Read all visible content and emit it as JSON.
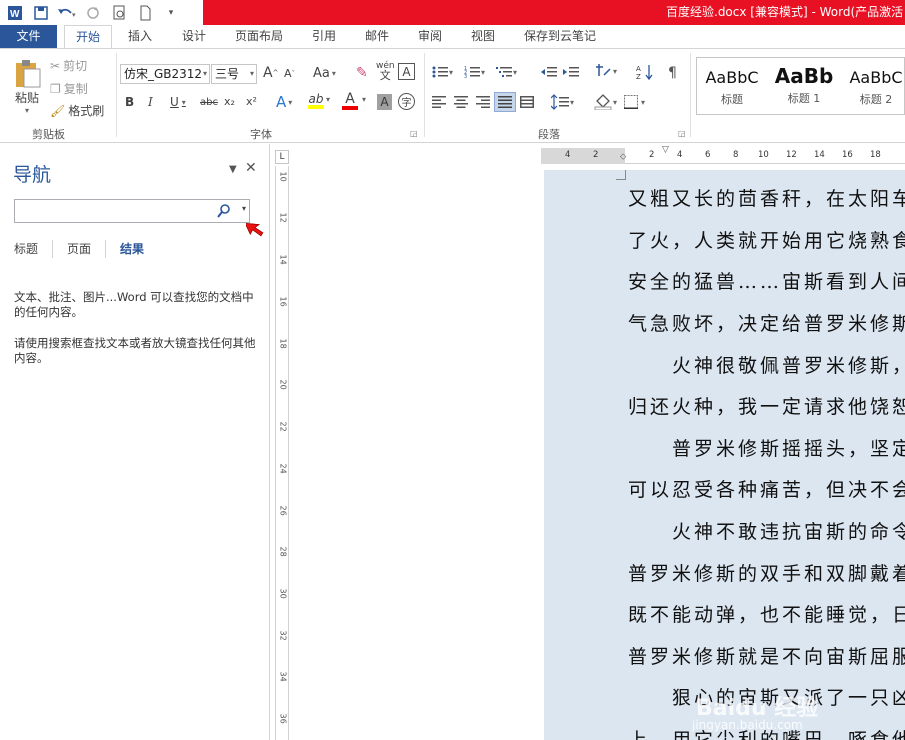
{
  "app": {
    "title": "百度经验.docx [兼容模式] - Word(产品激活",
    "accent": "#2b579a",
    "titlebar_color": "#e81123"
  },
  "qat": {
    "icons": [
      "word-logo-icon",
      "save-icon",
      "undo-icon",
      "redo-icon",
      "print-preview-icon",
      "new-doc-icon",
      "customize-icon"
    ]
  },
  "tabs": [
    "文件",
    "开始",
    "插入",
    "设计",
    "页面布局",
    "引用",
    "邮件",
    "审阅",
    "视图",
    "保存到云笔记"
  ],
  "ribbon": {
    "clipboard": {
      "paste": "粘贴",
      "cut": "剪切",
      "copy": "复制",
      "format_painter": "格式刷",
      "label": "剪贴板"
    },
    "font": {
      "font_name": "仿宋_GB2312",
      "font_size": "三号",
      "label": "字体",
      "bold": "B",
      "italic": "I",
      "underline": "U",
      "strike": "abc",
      "subscript": "x₂",
      "superscript": "x²",
      "change_case": "Aa",
      "phonetic": "wén",
      "char_border": "A",
      "text_effect": "A",
      "highlight": "ab",
      "font_color": "A",
      "char_shading": "A",
      "enclose": "字",
      "grow": "A",
      "shrink": "A"
    },
    "paragraph": {
      "label": "段落"
    },
    "styles": [
      {
        "preview": "AaBbC",
        "name": "标题"
      },
      {
        "preview": "AaBb",
        "name": "标题 1"
      },
      {
        "preview": "AaBbC",
        "name": "标题 2"
      }
    ]
  },
  "nav": {
    "title": "导航",
    "search_placeholder": "",
    "tabs": [
      "标题",
      "页面",
      "结果"
    ],
    "msg1": "文本、批注、图片...Word 可以查找您的文档中的任何内容。",
    "msg2": "请使用搜索框查找文本或者放大镜查找任何其他内容。"
  },
  "ruler": {
    "corner": "L",
    "h_ticks": [
      "4",
      "2",
      "2",
      "4",
      "6",
      "8",
      "10",
      "12",
      "14",
      "16",
      "18"
    ],
    "v_ticks": [
      "10",
      "12",
      "14",
      "16",
      "18",
      "20",
      "22",
      "24",
      "26",
      "28",
      "30",
      "32",
      "34",
      "36"
    ]
  },
  "document": {
    "lines": [
      "又粗又长的茴香秆，在太阳车",
      "了火，人类就开始用它烧熟食",
      "安全的猛兽……宙斯看到人间",
      "气急败坏，决定给普罗米修斯",
      "　　火神很敬佩普罗米修斯，",
      "归还火种，我一定请求他饶恕",
      "　　普罗米修斯摇摇头，坚定",
      "可以忍受各种痛苦，但决不会",
      "　　火神不敢违抗宙斯的命令",
      "普罗米修斯的双手和双脚戴着",
      "既不能动弹，也不能睡觉，日",
      "普罗米修斯就是不向宙斯屈服",
      "　　狠心的宙斯又派了一只凶",
      "上，用它尖利的嘴巴，啄食他"
    ]
  },
  "watermark": {
    "big": "Baidu 经验",
    "small": "jingyan.baidu.com"
  }
}
